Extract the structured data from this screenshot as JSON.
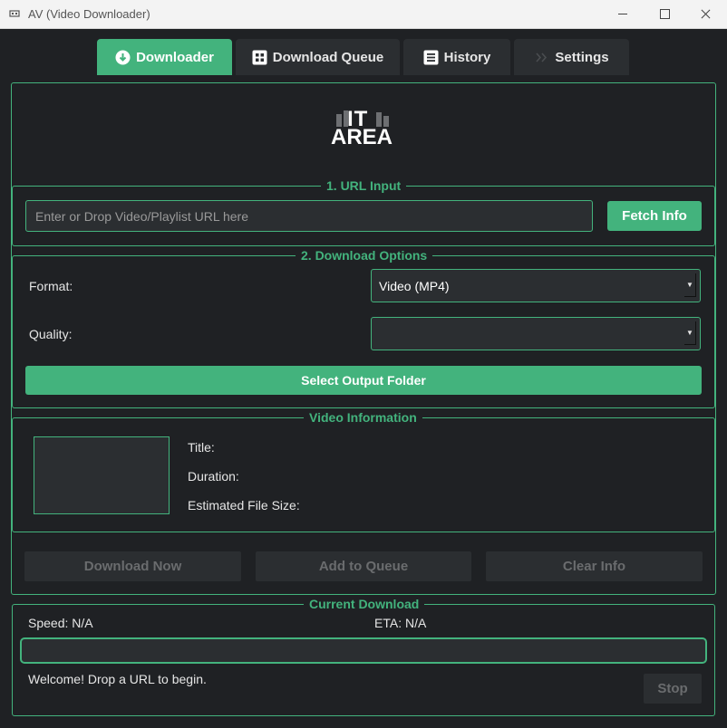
{
  "window": {
    "title": "AV (Video Downloader)",
    "app_icon": "av-icon"
  },
  "tabs": [
    {
      "label": "Downloader",
      "icon": "download-circle-icon",
      "active": true
    },
    {
      "label": "Download Queue",
      "icon": "grid-icon",
      "active": false
    },
    {
      "label": "History",
      "icon": "list-icon",
      "active": false
    },
    {
      "label": "Settings",
      "icon": "chevrons-right-icon",
      "active": false
    }
  ],
  "logo": {
    "line1": "IT",
    "line2": "AREA"
  },
  "url_input": {
    "section_title": "1. URL Input",
    "placeholder": "Enter or Drop Video/Playlist URL here",
    "value": "",
    "fetch_label": "Fetch Info"
  },
  "download_options": {
    "section_title": "2. Download Options",
    "format_label": "Format:",
    "format_value": "Video (MP4)",
    "quality_label": "Quality:",
    "quality_value": "",
    "output_folder_label": "Select Output Folder"
  },
  "video_info": {
    "section_title": "Video Information",
    "title_label": "Title:",
    "duration_label": "Duration:",
    "size_label": "Estimated File Size:"
  },
  "actions": {
    "download_now": "Download Now",
    "add_to_queue": "Add to Queue",
    "clear_info": "Clear Info"
  },
  "current_download": {
    "section_title": "Current Download",
    "speed": "Speed: N/A",
    "eta": "ETA: N/A",
    "progress_percent": 0,
    "status": "Welcome! Drop a URL to begin.",
    "stop_label": "Stop"
  },
  "colors": {
    "accent": "#43b37d",
    "background": "#1f2124",
    "surface": "#2b2e31",
    "disabled_text": "#6a6c6e"
  }
}
